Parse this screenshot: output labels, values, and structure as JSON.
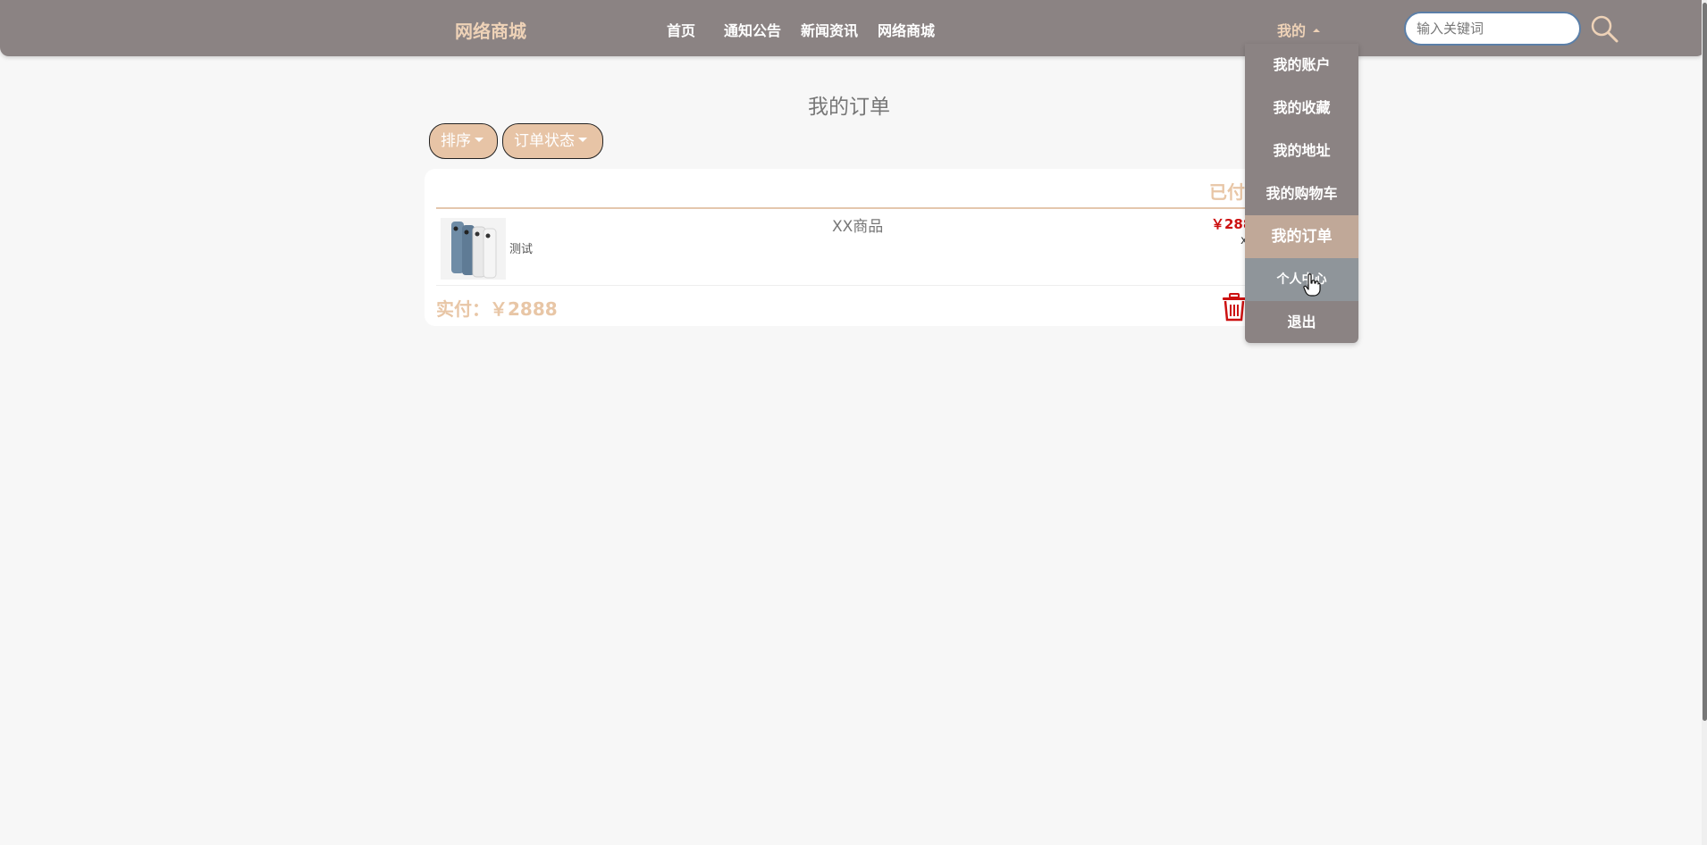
{
  "nav": {
    "brand": "网络商城",
    "links": [
      {
        "label": "首页"
      },
      {
        "label": "通知公告"
      },
      {
        "label": "新闻资讯"
      },
      {
        "label": "网络商城"
      }
    ],
    "my_label": "我的",
    "search": {
      "placeholder": "输入关键词",
      "value": ""
    }
  },
  "dropdown": {
    "items": [
      {
        "label": "我的账户"
      },
      {
        "label": "我的收藏"
      },
      {
        "label": "我的地址"
      },
      {
        "label": "我的购物车"
      },
      {
        "label": "我的订单",
        "active": true
      },
      {
        "label": "个人中心",
        "hovered": true
      },
      {
        "label": "退出"
      }
    ]
  },
  "page": {
    "title": "我的订单",
    "sort_label": "排序",
    "status_filter_label": "订单状态"
  },
  "order": {
    "status": "已付款",
    "product_desc": "测试",
    "product_name": "XX商品",
    "price": "￥2888",
    "quantity": "x1",
    "paid_total": "实付：￥2888"
  },
  "icons": {
    "search": "search-icon",
    "trash": "trash-icon",
    "cursor": "hand-cursor-icon"
  },
  "colors": {
    "nav_bg": "#8b8383",
    "accent": "#eed2b7",
    "button_bg": "#e7c4a6",
    "price": "#cc1111",
    "active_item": "#c0a898",
    "hover_item": "#8f959a"
  }
}
